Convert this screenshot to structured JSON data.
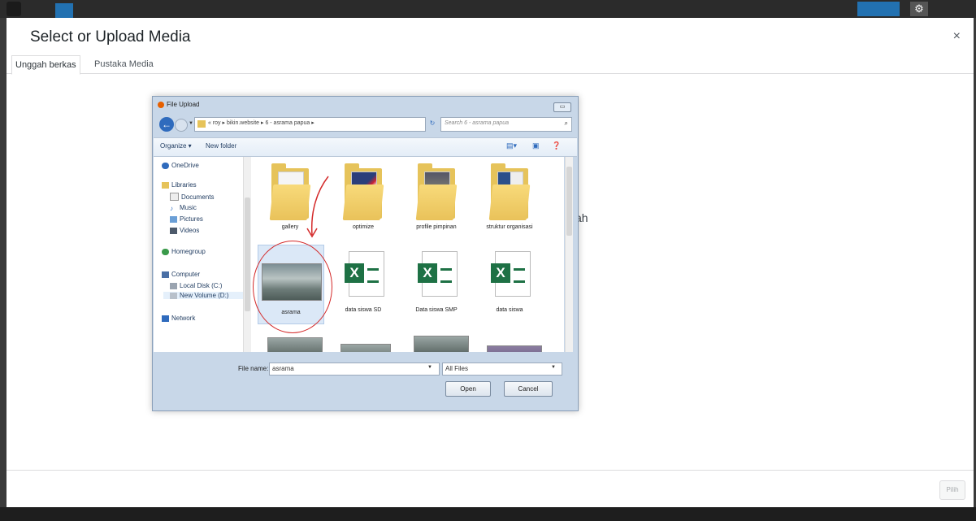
{
  "modal": {
    "title": "Select or Upload Media",
    "close": "×",
    "tabs": [
      "Unggah berkas",
      "Pustaka Media"
    ],
    "background_text": "ah",
    "select_button": "Pilih"
  },
  "dialog": {
    "title": "File Upload",
    "close": "▭",
    "address": "« roy ▸ bikin.website ▸ 6 - asrama papua ▸",
    "search_placeholder": "Search 6 - asrama papua",
    "toolbar": {
      "organize": "Organize ▾",
      "new_folder": "New folder"
    },
    "tree": [
      "OneDrive",
      "Libraries",
      "Documents",
      "Music",
      "Pictures",
      "Videos",
      "Homegroup",
      "Computer",
      "Local Disk (C:)",
      "New Volume (D:)",
      "Network"
    ],
    "files": [
      "gallery",
      "optimize",
      "profile pimpinan",
      "struktur organisasi",
      "asrama",
      "data siswa SD",
      "Data siswa SMP",
      "data siswa"
    ],
    "file_name_label": "File name:",
    "file_name_value": "asrama",
    "file_type": "All Files",
    "open": "Open",
    "cancel": "Cancel"
  },
  "colors": {
    "accent": "#2271b1",
    "annotation": "#d42a2a",
    "excel": "#1e7145"
  }
}
